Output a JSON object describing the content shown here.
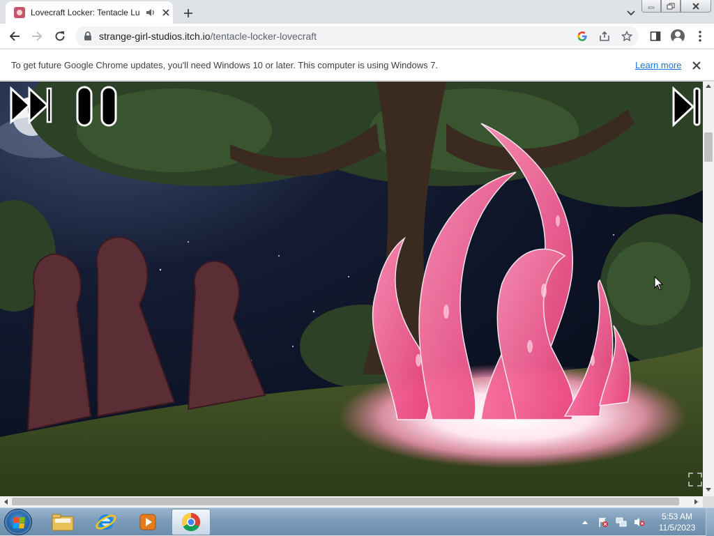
{
  "browser": {
    "tab": {
      "title": "Lovecraft Locker: Tentacle Lu",
      "favicon": "game-favicon",
      "audio_icon": "speaker-icon",
      "close_icon": "close-icon"
    },
    "new_tab_icon": "plus-icon",
    "tab_search_icon": "chevron-down-icon",
    "window_controls": [
      "minimize-icon",
      "restore-icon",
      "close-icon"
    ],
    "url": {
      "host": "strange-girl-studios.itch.io",
      "path": "/tentacle-locker-lovecraft"
    },
    "omnibox_icons": [
      "google-icon",
      "share-icon",
      "star-icon"
    ],
    "toolbar_icons": [
      "side-panel-icon",
      "profile-icon",
      "menu-icon"
    ]
  },
  "infobar": {
    "message": "To get future Google Chrome updates, you'll need Windows 10 or later. This computer is using Windows 7.",
    "link": "Learn more"
  },
  "game": {
    "controls": [
      "skip-icon",
      "pause-icon",
      "next-icon"
    ],
    "fullscreen_icon": "fullscreen-icon"
  },
  "taskbar": {
    "apps": [
      "file-explorer-icon",
      "internet-explorer-icon",
      "media-player-icon",
      "chrome-icon"
    ],
    "tray_icons": [
      "tray-expand-icon",
      "action-center-icon",
      "network-icon",
      "volume-muted-icon"
    ],
    "time": "5:53 AM",
    "date": "11/5/2023"
  },
  "colors": {
    "accent": "#1a73e8",
    "tentacle": "#f25c8c",
    "taskbar": "#7d9cb9"
  }
}
